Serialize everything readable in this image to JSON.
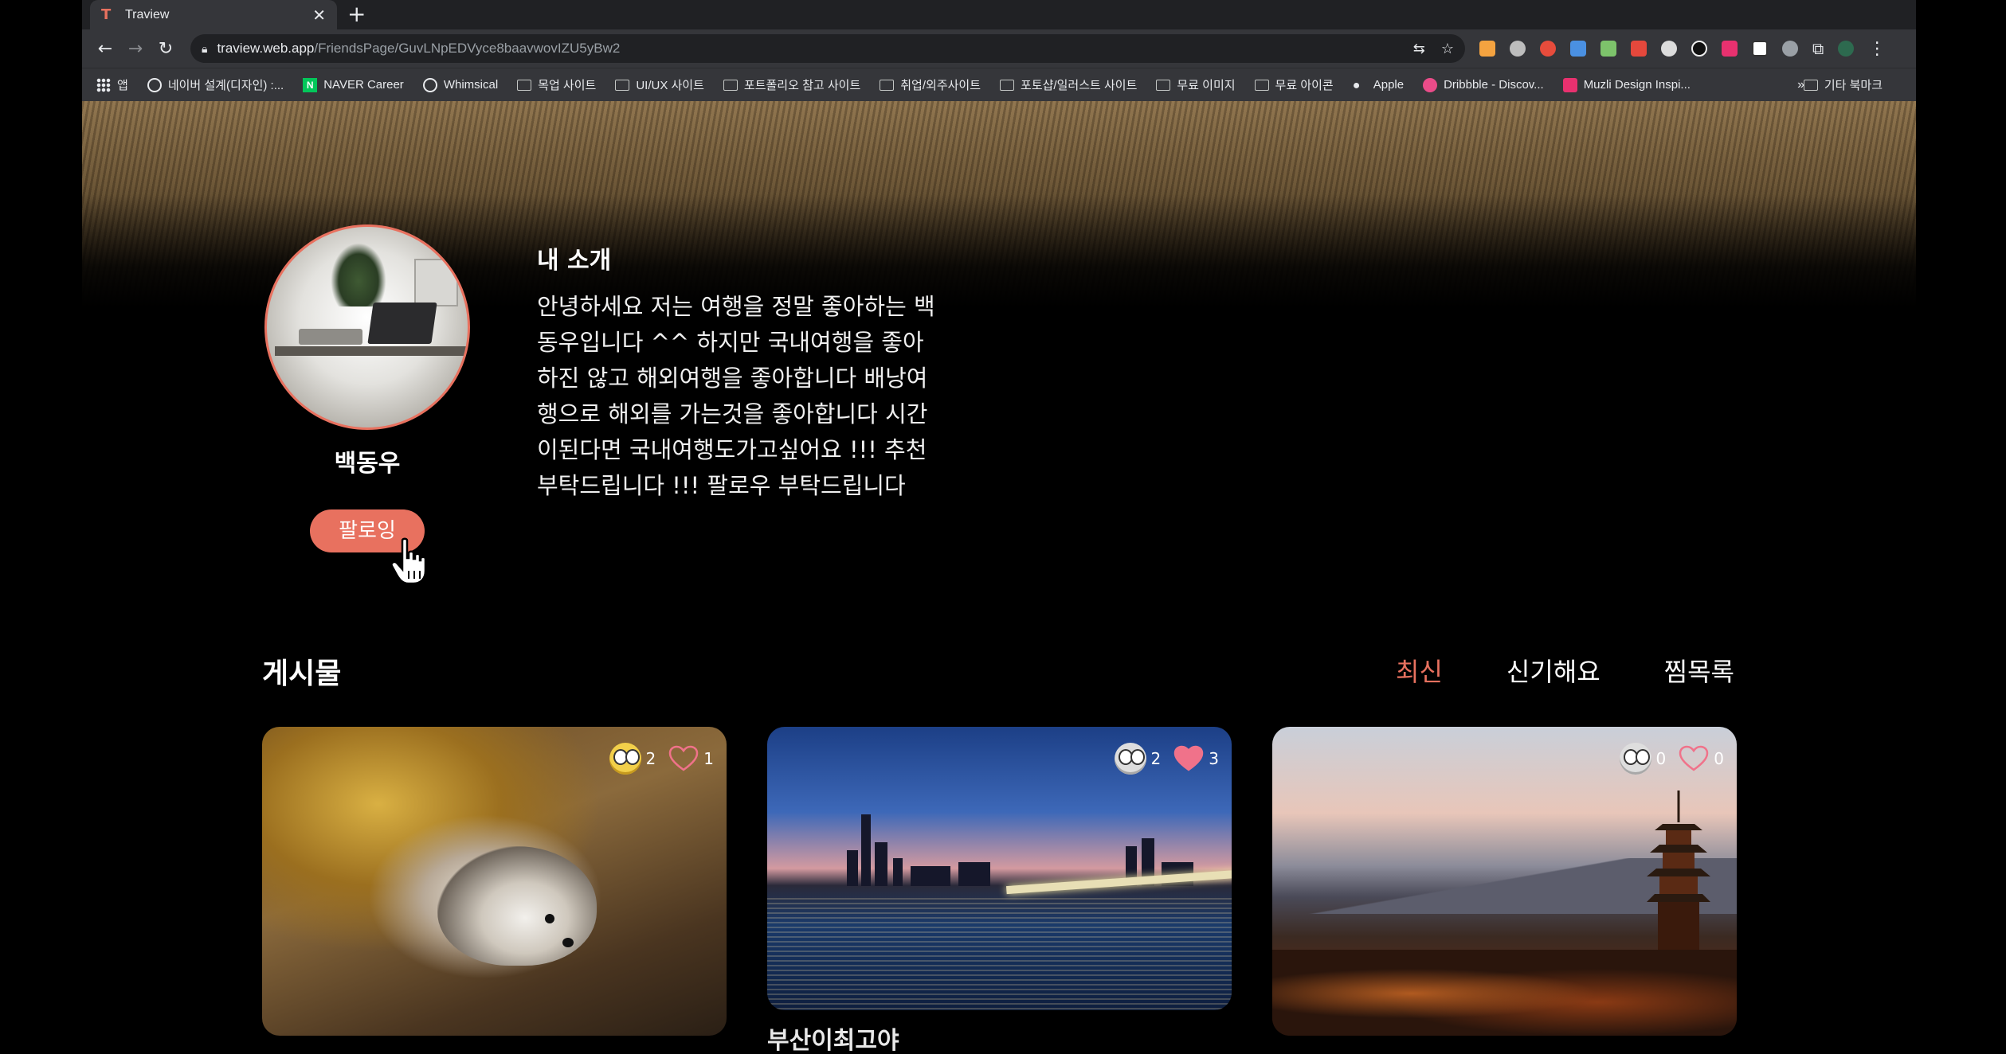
{
  "browser": {
    "tab_title": "Traview",
    "url_host": "traview.web.app",
    "url_path": "/FriendsPage/GuvLNpEDVyce8baavwovIZU5yBw2",
    "bookmarks": [
      {
        "label": "앱",
        "icon": "apps-icon"
      },
      {
        "label": "네이버 설계(디자인) :...",
        "icon": "globe-icon"
      },
      {
        "label": "NAVER Career",
        "icon": "naver-icon"
      },
      {
        "label": "Whimsical",
        "icon": "globe-icon"
      },
      {
        "label": "목업 사이트",
        "icon": "folder-icon"
      },
      {
        "label": "UI/UX 사이트",
        "icon": "folder-icon"
      },
      {
        "label": "포트폴리오 참고 사이트",
        "icon": "folder-icon"
      },
      {
        "label": "취업/외주사이트",
        "icon": "folder-icon"
      },
      {
        "label": "포토샵/일러스트 사이트",
        "icon": "folder-icon"
      },
      {
        "label": "무료 이미지",
        "icon": "folder-icon"
      },
      {
        "label": "무료 아이콘",
        "icon": "folder-icon"
      },
      {
        "label": "Apple",
        "icon": "apple-icon"
      },
      {
        "label": "Dribbble - Discov...",
        "icon": "dribbble-icon"
      },
      {
        "label": "Muzli Design Inspi...",
        "icon": "muzli-icon"
      }
    ],
    "bookmarks_more": "»",
    "other_bookmarks": "기타 북마크"
  },
  "profile": {
    "name": "백동우",
    "follow_label": "팔로잉",
    "intro_title": "내 소개",
    "intro_text": "안녕하세요 저는 여행을 정말 좋아하는 백동우입니다 ^^ 하지만 국내여행을 좋아하진 않고 해외여행을 좋아합니다 배낭여행으로 해외를 가는것을 좋아합니다 시간이된다면 국내여행도가고싶어요 !!! 추천부탁드립니다 !!! 팔로우 부탁드립니다"
  },
  "posts": {
    "section_title": "게시물",
    "sort_tabs": [
      {
        "label": "최신",
        "active": true
      },
      {
        "label": "신기해요",
        "active": false
      },
      {
        "label": "찜목록",
        "active": false
      }
    ],
    "cards": [
      {
        "wow_count": "2",
        "like_count": "1",
        "title": "",
        "image": "hedgehog",
        "liked": false,
        "wow_active": true
      },
      {
        "wow_count": "2",
        "like_count": "3",
        "title": "부산이최고야",
        "image": "city-night-river",
        "liked": true,
        "wow_active": false
      },
      {
        "wow_count": "0",
        "like_count": "0",
        "title": "",
        "image": "pagoda-sunset",
        "liked": false,
        "wow_active": false
      }
    ]
  },
  "colors": {
    "accent": "#e8715f",
    "like_filled": "#f0728a",
    "background": "#000000"
  }
}
